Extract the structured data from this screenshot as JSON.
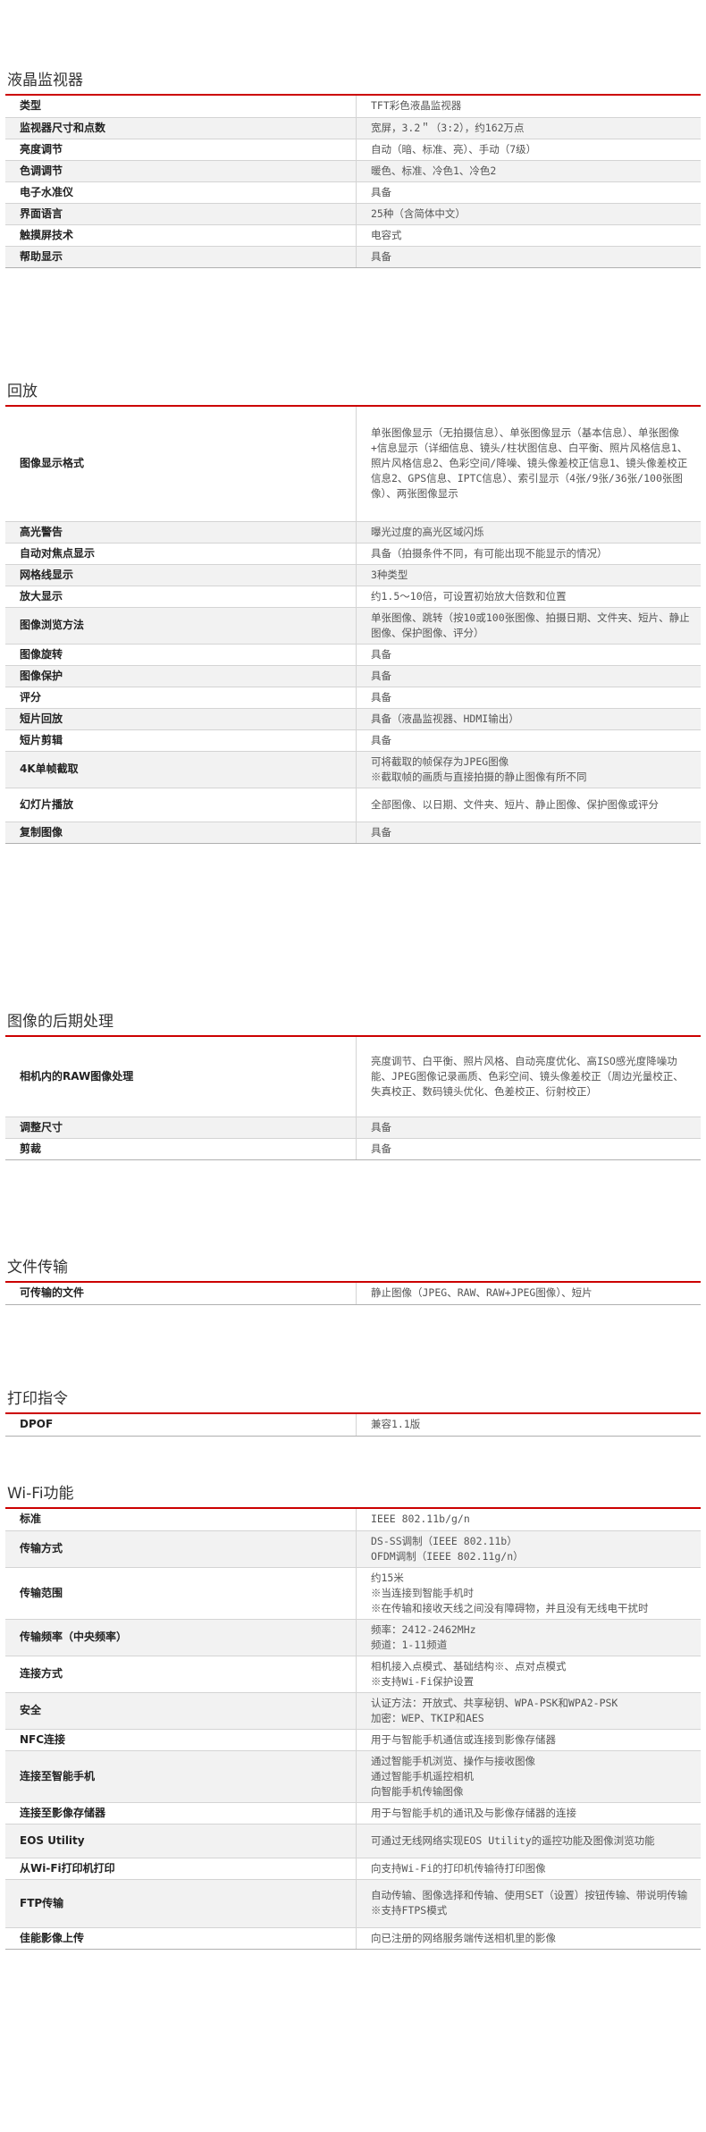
{
  "sections": [
    {
      "title": "液晶监视器",
      "rows": [
        {
          "key": "类型",
          "value": "TFT彩色液晶监视器"
        },
        {
          "key": "监视器尺寸和点数",
          "value": "宽屏，3.2＂（3:2），约162万点"
        },
        {
          "key": "亮度调节",
          "value": "自动（暗、标准、亮）、手动（7级）"
        },
        {
          "key": "色调调节",
          "value": "暖色、标准、冷色1、冷色2"
        },
        {
          "key": "电子水准仪",
          "value": "具备"
        },
        {
          "key": "界面语言",
          "value": "25种（含简体中文）"
        },
        {
          "key": "触摸屏技术",
          "value": "电容式"
        },
        {
          "key": "帮助显示",
          "value": "具备"
        }
      ]
    },
    {
      "title": "回放",
      "rows": [
        {
          "key": "图像显示格式",
          "value": "单张图像显示（无拍摄信息）、单张图像显示（基本信息）、单张图像+信息显示（详细信息、镜头/柱状图信息、白平衡、照片风格信息1、照片风格信息2、色彩空间/降噪、镜头像差校正信息1、镜头像差校正信息2、GPS信息、IPTC信息）、索引显示（4张/9张/36张/100张图像）、两张图像显示"
        },
        {
          "key": "高光警告",
          "value": "曝光过度的高光区域闪烁"
        },
        {
          "key": "自动对焦点显示",
          "value": "具备（拍摄条件不同，有可能出现不能显示的情况）"
        },
        {
          "key": "网格线显示",
          "value": "3种类型"
        },
        {
          "key": "放大显示",
          "value": "约1.5～10倍，可设置初始放大倍数和位置"
        },
        {
          "key": "图像浏览方法",
          "value": "单张图像、跳转（按10或100张图像、拍摄日期、文件夹、短片、静止图像、保护图像、评分）"
        },
        {
          "key": "图像旋转",
          "value": "具备"
        },
        {
          "key": "图像保护",
          "value": "具备"
        },
        {
          "key": "评分",
          "value": "具备"
        },
        {
          "key": "短片回放",
          "value": "具备（液晶监视器、HDMI输出）"
        },
        {
          "key": "短片剪辑",
          "value": "具备"
        },
        {
          "key": "4K单帧截取",
          "value": "可将截取的帧保存为JPEG图像\n※截取帧的画质与直接拍摄的静止图像有所不同"
        },
        {
          "key": "幻灯片播放",
          "value": "全部图像、以日期、文件夹、短片、静止图像、保护图像或评分"
        },
        {
          "key": "复制图像",
          "value": "具备"
        }
      ]
    },
    {
      "title": "图像的后期处理",
      "rows": [
        {
          "key": "相机内的RAW图像处理",
          "value": "亮度调节、白平衡、照片风格、自动亮度优化、高ISO感光度降噪功能、JPEG图像记录画质、色彩空间、镜头像差校正（周边光量校正、失真校正、数码镜头优化、色差校正、衍射校正）"
        },
        {
          "key": "调整尺寸",
          "value": "具备"
        },
        {
          "key": "剪裁",
          "value": "具备"
        }
      ]
    },
    {
      "title": "文件传输",
      "rows": [
        {
          "key": "可传输的文件",
          "value": "静止图像（JPEG、RAW、RAW+JPEG图像）、短片"
        }
      ]
    },
    {
      "title": "打印指令",
      "rows": [
        {
          "key": "DPOF",
          "value": "兼容1.1版"
        }
      ]
    },
    {
      "title": "Wi-Fi功能",
      "rows": [
        {
          "key": "标准",
          "value": "IEEE 802.11b/g/n"
        },
        {
          "key": "传输方式",
          "value": "DS-SS调制（IEEE 802.11b）\nOFDM调制（IEEE 802.11g/n）"
        },
        {
          "key": "传输范围",
          "value": "约15米\n※当连接到智能手机时\n※在传输和接收天线之间没有障碍物，并且没有无线电干扰时"
        },
        {
          "key": "传输频率（中央频率）",
          "value": "频率：2412-2462MHz\n频道：1-11频道"
        },
        {
          "key": "连接方式",
          "value": "相机接入点模式、基础结构※、点对点模式\n※支持Wi-Fi保护设置"
        },
        {
          "key": "安全",
          "value": "认证方法：开放式、共享秘钥、WPA-PSK和WPA2-PSK\n加密：WEP、TKIP和AES"
        },
        {
          "key": "NFC连接",
          "value": "用于与智能手机通信或连接到影像存储器"
        },
        {
          "key": "连接至智能手机",
          "value": "通过智能手机浏览、操作与接收图像\n通过智能手机遥控相机\n向智能手机传输图像"
        },
        {
          "key": "连接至影像存储器",
          "value": "用于与智能手机的通讯及与影像存储器的连接"
        },
        {
          "key": "EOS Utility",
          "value": "可通过无线网络实现EOS Utility的遥控功能及图像浏览功能"
        },
        {
          "key": "从Wi-Fi打印机打印",
          "value": "向支持Wi-Fi的打印机传输待打印图像"
        },
        {
          "key": "FTP传输",
          "value": "自动传输、图像选择和传输、使用SET（设置）按钮传输、带说明传输\n※支持FTPS模式"
        },
        {
          "key": "佳能影像上传",
          "value": "向已注册的网络服务端传送相机里的影像"
        }
      ]
    }
  ]
}
